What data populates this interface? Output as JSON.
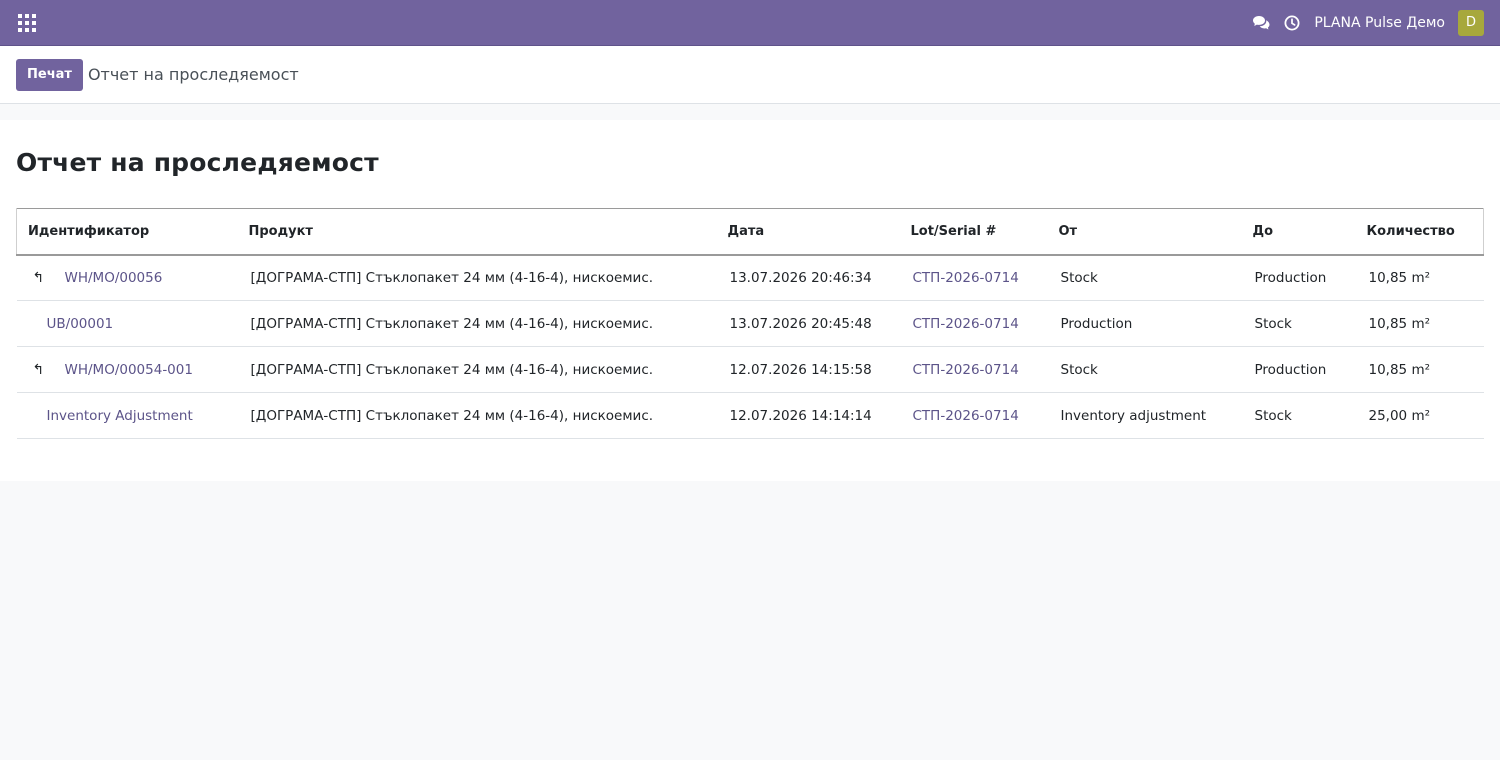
{
  "navbar": {
    "company": "PLANA Pulse Демо",
    "avatar_letter": "D",
    "icons": [
      "apps-icon",
      "chat-icon",
      "clock-icon"
    ]
  },
  "control_panel": {
    "print_label": "Печат",
    "breadcrumb": "Отчет на проследяемост"
  },
  "report": {
    "title": "Отчет на проследяемост",
    "columns": [
      "Идентификатор",
      "Продукт",
      "Дата",
      "Lot/Serial #",
      "От",
      "До",
      "Количество"
    ],
    "rows": [
      {
        "ref": "WH/MO/00056",
        "product": "[ДОГРАМА-СТП] Стъклопакет 24 мм (4-16-4), нискоемис.",
        "date": "13.07.2026 20:46:34",
        "lot": "СТП-2026-0714",
        "from": "Stock",
        "to": "Production",
        "qty": "10,85 m²"
      },
      {
        "ref": "UB/00001",
        "product": "[ДОГРАМА-СТП] Стъклопакет 24 мм (4-16-4), нискоемис.",
        "date": "13.07.2026 20:45:48",
        "lot": "СТП-2026-0714",
        "from": "Production",
        "to": "Stock",
        "qty": "10,85 m²"
      },
      {
        "ref": "WH/MO/00054-001",
        "product": "[ДОГРАМА-СТП] Стъклопакет 24 мм (4-16-4), нискоемис.",
        "date": "12.07.2026 14:15:58",
        "lot": "СТП-2026-0714",
        "from": "Stock",
        "to": "Production",
        "qty": "10,85 m²"
      },
      {
        "ref": "Inventory Adjustment",
        "product": "[ДОГРАМА-СТП] Стъклопакет 24 мм (4-16-4), нискоемис.",
        "date": "12.07.2026 14:14:14",
        "lot": "СТП-2026-0714",
        "from": "Inventory adjustment",
        "to": "Stock",
        "qty": "25,00 m²"
      }
    ]
  },
  "colors": {
    "brand": "#71639e",
    "link": "#5c5489",
    "avatar": "#a7a83c"
  }
}
